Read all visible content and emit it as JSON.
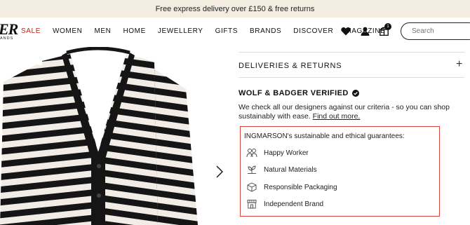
{
  "promo": {
    "text": "Free express delivery over £150 & free returns"
  },
  "header": {
    "logo": "ER",
    "logo_sub": "ANDS",
    "menu": [
      "SALE",
      "WOMEN",
      "MEN",
      "HOME",
      "JEWELLERY",
      "GIFTS",
      "BRANDS",
      "DISCOVER",
      "MAGAZINE"
    ],
    "bag_count": "1",
    "search_placeholder": "Search"
  },
  "details": {
    "deliveries_label": "DELIVERIES & RETURNS",
    "plus": "+",
    "verified_title": "WOLF & BADGER VERIFIED",
    "verified_desc": "We check all our designers against our criteria - so you can shop sustainably with ease.",
    "find_out_more": "Find out more.",
    "guarantees_title": "INGMARSON's sustainable and ethical guarantees:",
    "guarantees": [
      {
        "label": "Happy Worker",
        "icon": "happy-worker-icon"
      },
      {
        "label": "Natural Materials",
        "icon": "natural-materials-icon"
      },
      {
        "label": "Responsible Packaging",
        "icon": "packaging-box-icon"
      },
      {
        "label": "Independent Brand",
        "icon": "storefront-icon"
      }
    ]
  },
  "colors": {
    "sale": "#c8201d",
    "promo_bg": "#f3ede1",
    "highlight_border": "#d9463b"
  }
}
